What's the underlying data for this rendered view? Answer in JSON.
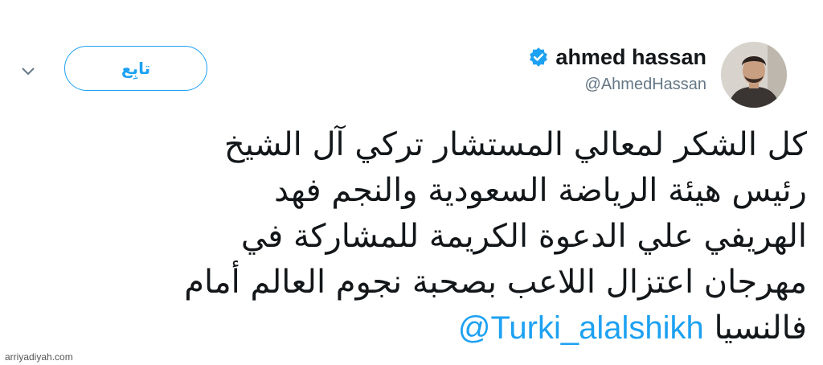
{
  "tweet": {
    "display_name": "ahmed hassan",
    "handle": "@AhmedHassan",
    "follow_label": "تابِع",
    "text_lines": [
      "كل الشكر لمعالي المستشار تركي آل الشيخ",
      "رئيس هيئة الرياضة السعودية والنجم فهد",
      "الهريفي علي الدعوة الكريمة للمشاركة في",
      "مهرجان اعتزال اللاعب بصحبة نجوم العالم أمام"
    ],
    "last_line_text": "فالنسيا",
    "mention": "@Turki_alalshikh"
  },
  "watermark": "arriyadiyah.com",
  "icons": {
    "verified": "verified-badge-icon",
    "chevron": "chevron-down-icon"
  },
  "colors": {
    "accent": "#1da1f2",
    "text": "#14171a",
    "secondary": "#657786"
  }
}
